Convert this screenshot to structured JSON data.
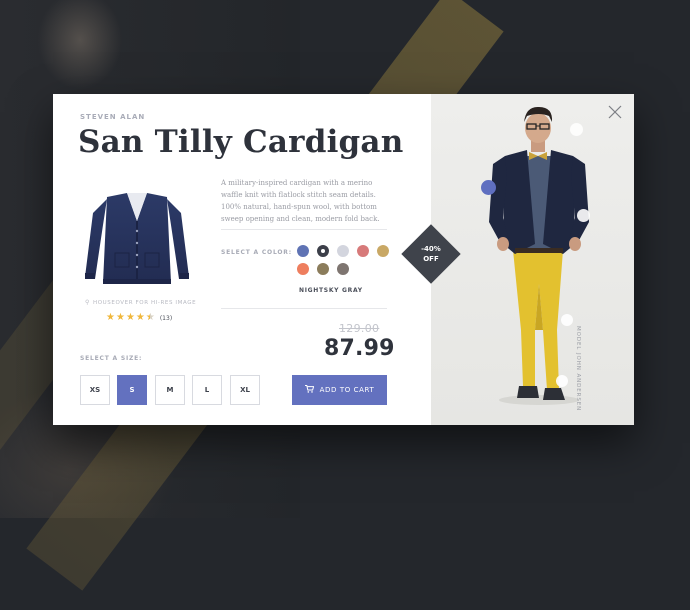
{
  "product": {
    "brand": "STEVEN ALAN",
    "title": "San Tilly Cardigan",
    "description": "A military-inspired cardigan with a merino waffle knit with flatlock stitch seam details. 100% natural, hand-spun wool, with bottom sweep opening and clean, modern fold back.",
    "hover_hint": "HOUSEOVER FOR HI-RES IMAGE",
    "rating": {
      "stars": 4.5,
      "count": "(13)"
    },
    "color_label": "SELECT A COLOR:",
    "colors": [
      {
        "name": "blue",
        "hex": "#5f73b4",
        "selected": false
      },
      {
        "name": "navy",
        "hex": "#3c3f49",
        "selected": true
      },
      {
        "name": "light-gray",
        "hex": "#d3d5de",
        "selected": false
      },
      {
        "name": "rose",
        "hex": "#d77a7a",
        "selected": false
      },
      {
        "name": "tan",
        "hex": "#c9a865",
        "selected": false
      },
      {
        "name": "coral",
        "hex": "#ee7e5e",
        "selected": false
      },
      {
        "name": "olive",
        "hex": "#8b7c5b",
        "selected": false
      },
      {
        "name": "taupe",
        "hex": "#7e7570",
        "selected": false
      }
    ],
    "selected_color_name": "NIGHTSKY GRAY",
    "old_price": "129.00",
    "price": "87.99",
    "discount_line1": "-40%",
    "discount_line2": "OFF",
    "size_label": "SELECT A SIZE:",
    "sizes": [
      "XS",
      "S",
      "M",
      "L",
      "XL"
    ],
    "selected_size": "S",
    "add_to_cart": "ADD TO CART",
    "model_credit": "MODEL JOHN ANDERSEN"
  },
  "colors": {
    "accent": "#6371bf",
    "title": "#2e323b",
    "rating_star": "#f0b73c",
    "discount_badge": "#3f434b",
    "background": "#24272c"
  }
}
